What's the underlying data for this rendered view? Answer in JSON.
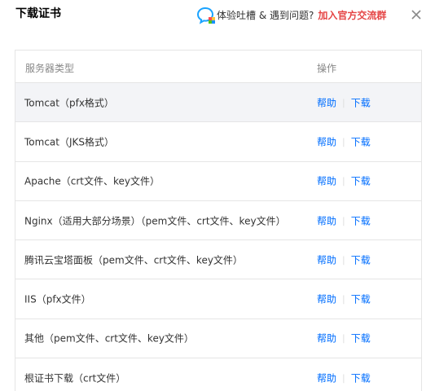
{
  "dialog": {
    "title": "下载证书",
    "feedback_text": "体验吐槽 & 遇到问题?",
    "feedback_link": "加入官方交流群",
    "colors": {
      "link": "#006eff",
      "feedback_link": "#e54545",
      "hover_row": "#f3f4f7"
    }
  },
  "table": {
    "headers": {
      "type": "服务器类型",
      "operation": "操作"
    },
    "rows": [
      {
        "type": "Tomcat（pfx格式）",
        "help": "帮助",
        "download": "下载"
      },
      {
        "type": "Tomcat（JKS格式）",
        "help": "帮助",
        "download": "下载"
      },
      {
        "type": "Apache（crt文件、key文件）",
        "help": "帮助",
        "download": "下载"
      },
      {
        "type": "Nginx（适用大部分场景）（pem文件、crt文件、key文件）",
        "help": "帮助",
        "download": "下载"
      },
      {
        "type": "腾讯云宝塔面板（pem文件、crt文件、key文件）",
        "help": "帮助",
        "download": "下载"
      },
      {
        "type": "IIS（pfx文件）",
        "help": "帮助",
        "download": "下载"
      },
      {
        "type": "其他（pem文件、crt文件、key文件）",
        "help": "帮助",
        "download": "下载"
      },
      {
        "type": "根证书下载（crt文件）",
        "help": "帮助",
        "download": "下载"
      }
    ]
  }
}
